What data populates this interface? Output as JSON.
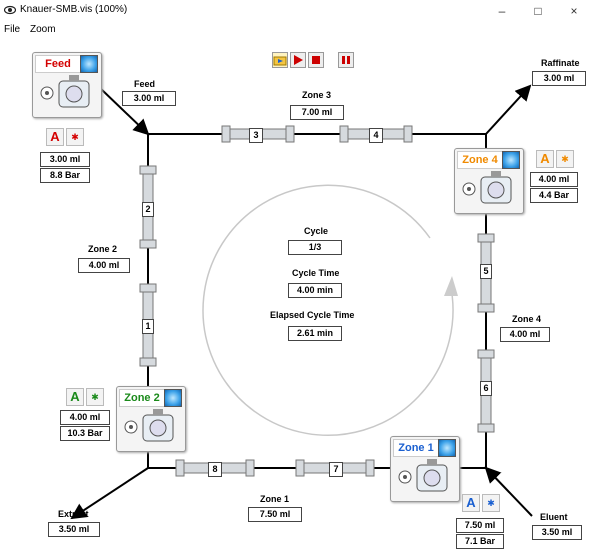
{
  "window": {
    "title": "Knauer-SMB.vis (100%)",
    "minimize": "–",
    "maximize": "□",
    "close": "×"
  },
  "menu": {
    "file": "File",
    "zoom": "Zoom"
  },
  "colors": {
    "feed": "#d40000",
    "zone2": "#1a8a1a",
    "zone1": "#1a5fd0",
    "zone4": "#f08a00",
    "line": "#000000",
    "column": "#d0d4d8"
  },
  "feed": {
    "pump_label": "Feed",
    "label": "Feed",
    "flow": "3.00 ml",
    "ctrl_flow": "3.00 ml",
    "pressure": "8.8 Bar",
    "a_label": "A"
  },
  "raffinate": {
    "label": "Raffinate",
    "flow": "3.00 ml"
  },
  "zone3": {
    "label": "Zone 3",
    "flow": "7.00 ml"
  },
  "zone4_pump": {
    "pump_label": "Zone 4",
    "ctrl_flow": "4.00 ml",
    "pressure": "4.4 Bar",
    "a_label": "A"
  },
  "zone2": {
    "label": "Zone 2",
    "flow": "4.00 ml"
  },
  "zone2_pump": {
    "pump_label": "Zone 2",
    "ctrl_flow": "4.00 ml",
    "pressure": "10.3 Bar",
    "a_label": "A"
  },
  "zone4": {
    "label": "Zone 4",
    "flow": "4.00 ml"
  },
  "zone1": {
    "label": "Zone 1",
    "flow": "7.50 ml"
  },
  "zone1_pump": {
    "pump_label": "Zone 1",
    "ctrl_flow": "7.50 ml",
    "pressure": "7.1 Bar",
    "a_label": "A"
  },
  "extract": {
    "label": "Extract",
    "flow": "3.50 ml"
  },
  "eluent": {
    "label": "Eluent",
    "flow": "3.50 ml"
  },
  "cycle": {
    "label": "Cycle",
    "value": "1/3",
    "time_label": "Cycle Time",
    "time_value": "4.00 min",
    "elapsed_label": "Elapsed Cycle Time",
    "elapsed_value": "2.61 min"
  },
  "columns": {
    "c1": "1",
    "c2": "2",
    "c3": "3",
    "c4": "4",
    "c5": "5",
    "c6": "6",
    "c7": "7",
    "c8": "8"
  }
}
